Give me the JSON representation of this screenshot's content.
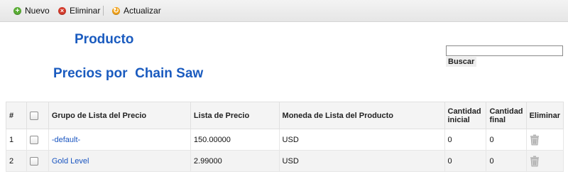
{
  "toolbar": {
    "new_label": "Nuevo",
    "delete_label": "Eliminar",
    "update_label": "Actualizar"
  },
  "header": {
    "product_title": "Producto",
    "prices_title": "Precios por  Chain Saw"
  },
  "search": {
    "value": "",
    "button_label": "Buscar"
  },
  "table": {
    "columns": {
      "number": "#",
      "price_list_group": "Grupo de Lista del Precio",
      "price_list": "Lista de Precio",
      "currency": "Moneda de Lista del Producto",
      "qty_initial": "Cantidad inicial",
      "qty_final": "Cantidad final",
      "delete": "Eliminar"
    },
    "rows": [
      {
        "number": "1",
        "group": "-default-",
        "price": "150.00000",
        "currency": "USD",
        "qty_initial": "0",
        "qty_final": "0"
      },
      {
        "number": "2",
        "group": "Gold Level",
        "price": "2.99000",
        "currency": "USD",
        "qty_initial": "0",
        "qty_final": "0"
      }
    ]
  },
  "colors": {
    "title_blue": "#1a5bbf",
    "link_blue": "#1a55c0",
    "new_icon": "#5aad35",
    "delete_icon": "#d33b2c",
    "update_icon": "#f2a31c"
  },
  "icons": {
    "new": "plus-circle-icon",
    "delete": "x-circle-icon",
    "update": "refresh-circle-icon",
    "row_delete": "trash-icon"
  }
}
